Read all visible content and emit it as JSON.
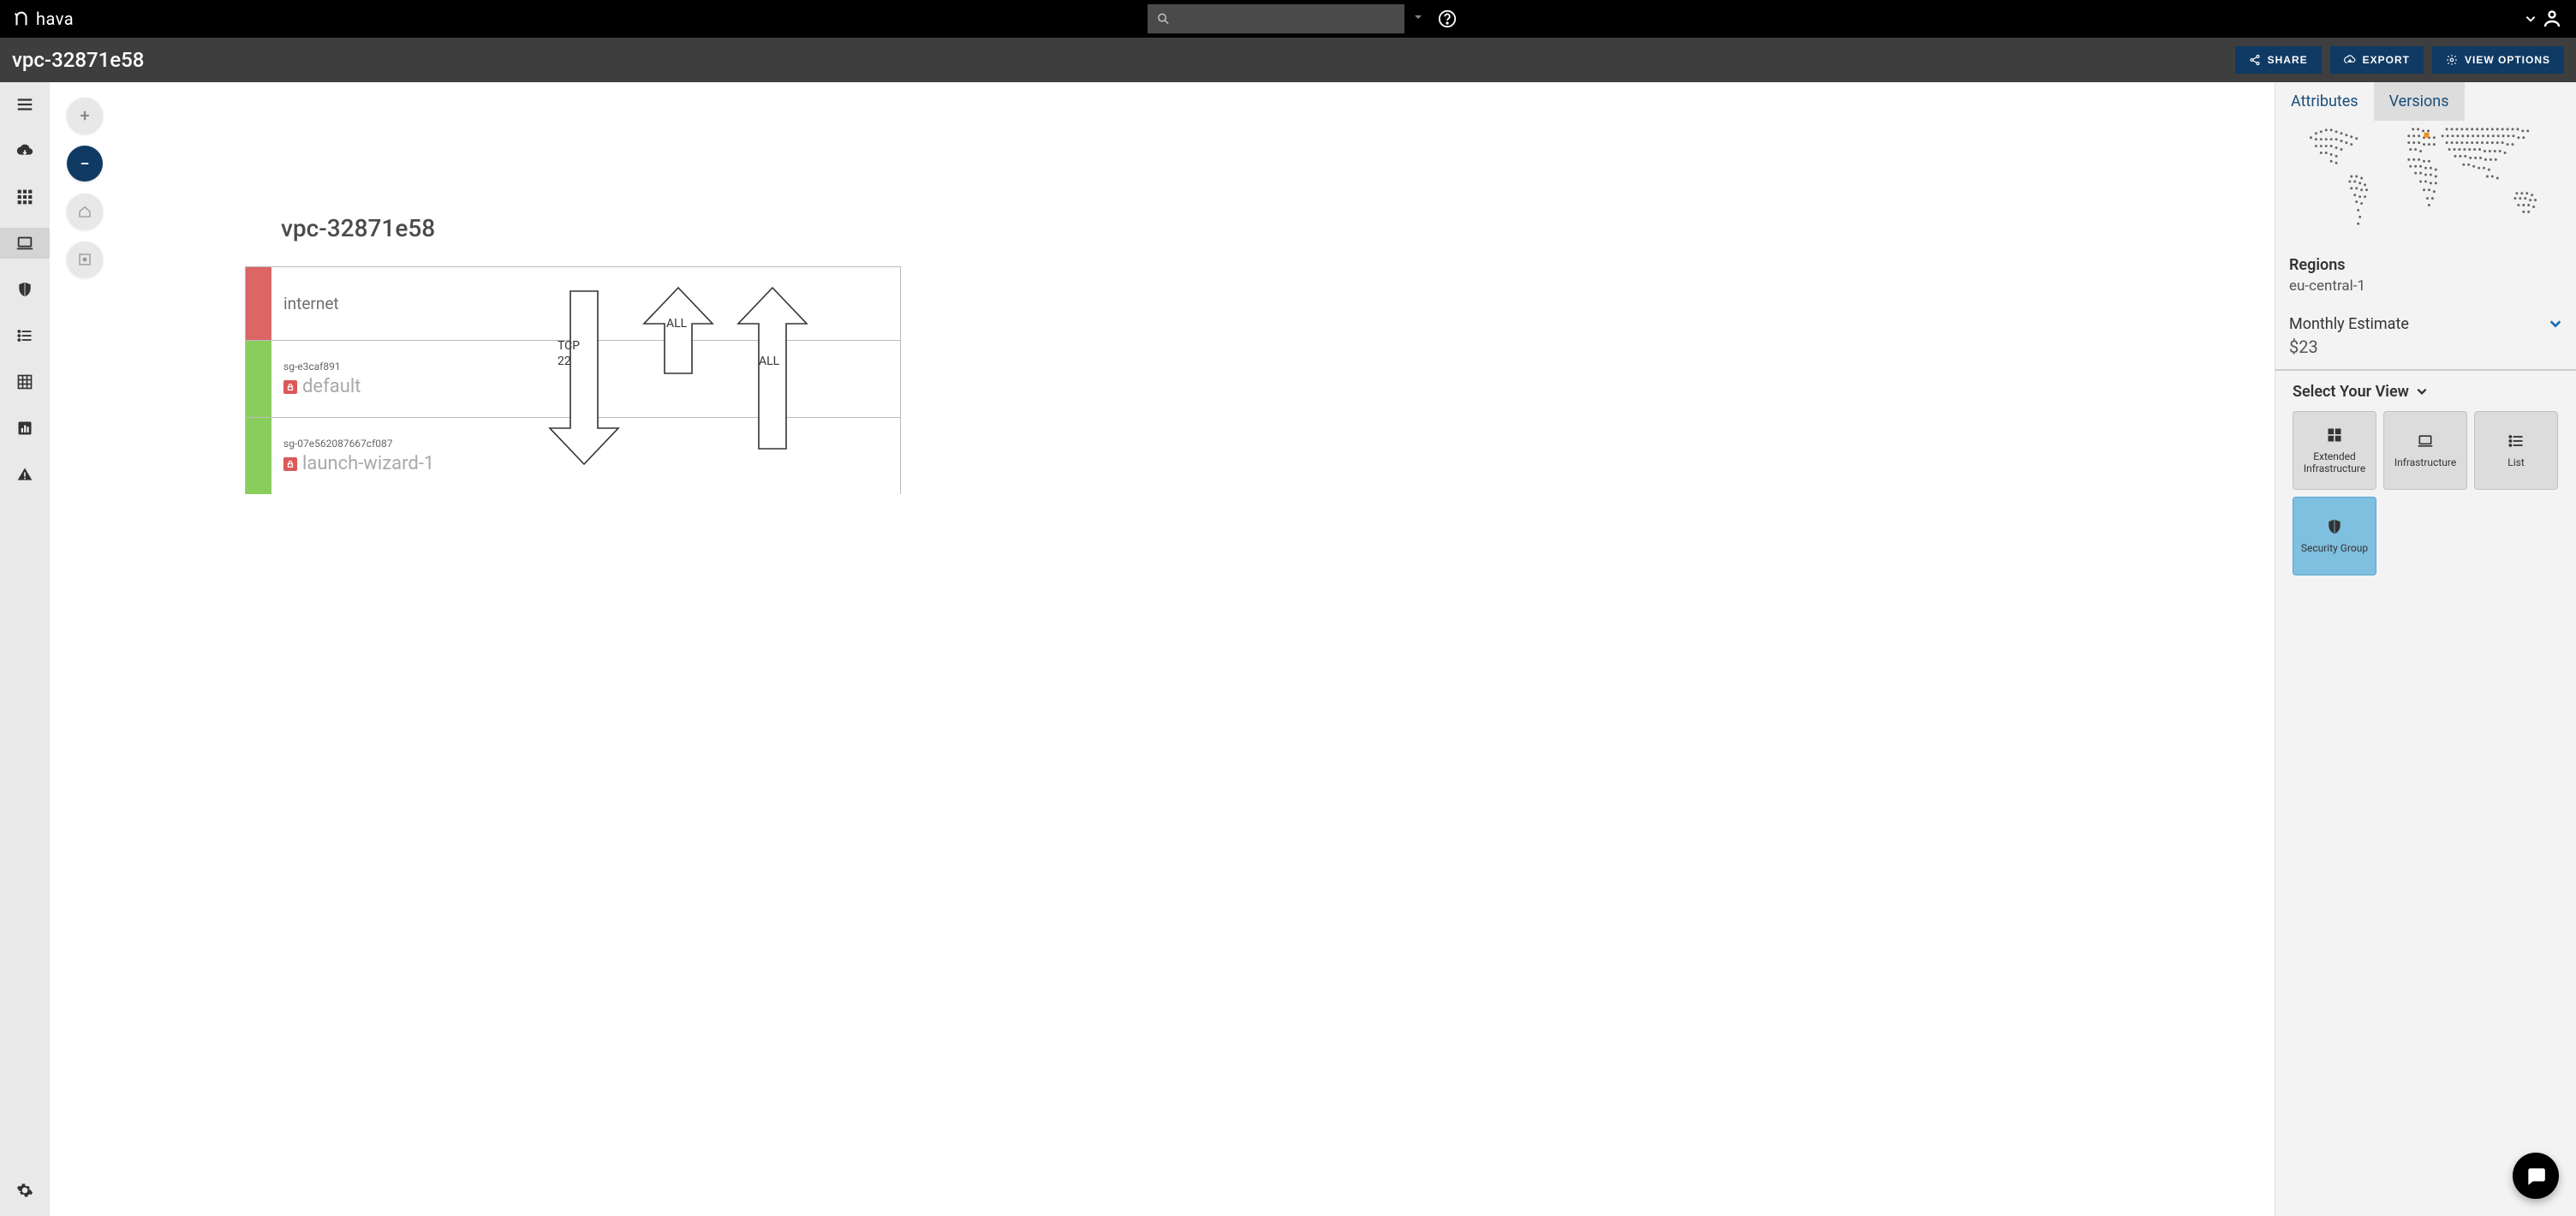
{
  "app": {
    "name": "hava"
  },
  "header": {
    "title": "vpc-32871e58",
    "actions": {
      "share": "SHARE",
      "export": "EXPORT",
      "view_options": "VIEW OPTIONS"
    }
  },
  "diagram": {
    "title": "vpc-32871e58",
    "rows": [
      {
        "label": "internet",
        "color": "red"
      },
      {
        "sg_id": "sg-e3caf891",
        "sg_name": "default",
        "color": "green"
      },
      {
        "sg_id": "sg-07e562087667cf087",
        "sg_name": "launch-wizard-1",
        "color": "green"
      }
    ],
    "arrows": {
      "down_protocol": "TCP",
      "down_port": "22",
      "up1": "ALL",
      "up2": "ALL"
    }
  },
  "panel": {
    "tabs": {
      "attributes": "Attributes",
      "versions": "Versions"
    },
    "regions": {
      "label": "Regions",
      "value": "eu-central-1"
    },
    "estimate": {
      "label": "Monthly Estimate",
      "value": "$23"
    },
    "select_view": {
      "label": "Select Your View",
      "options": {
        "ext_infra": "Extended Infrastructure",
        "infra": "Infrastructure",
        "list": "List",
        "security": "Security Group"
      }
    }
  }
}
